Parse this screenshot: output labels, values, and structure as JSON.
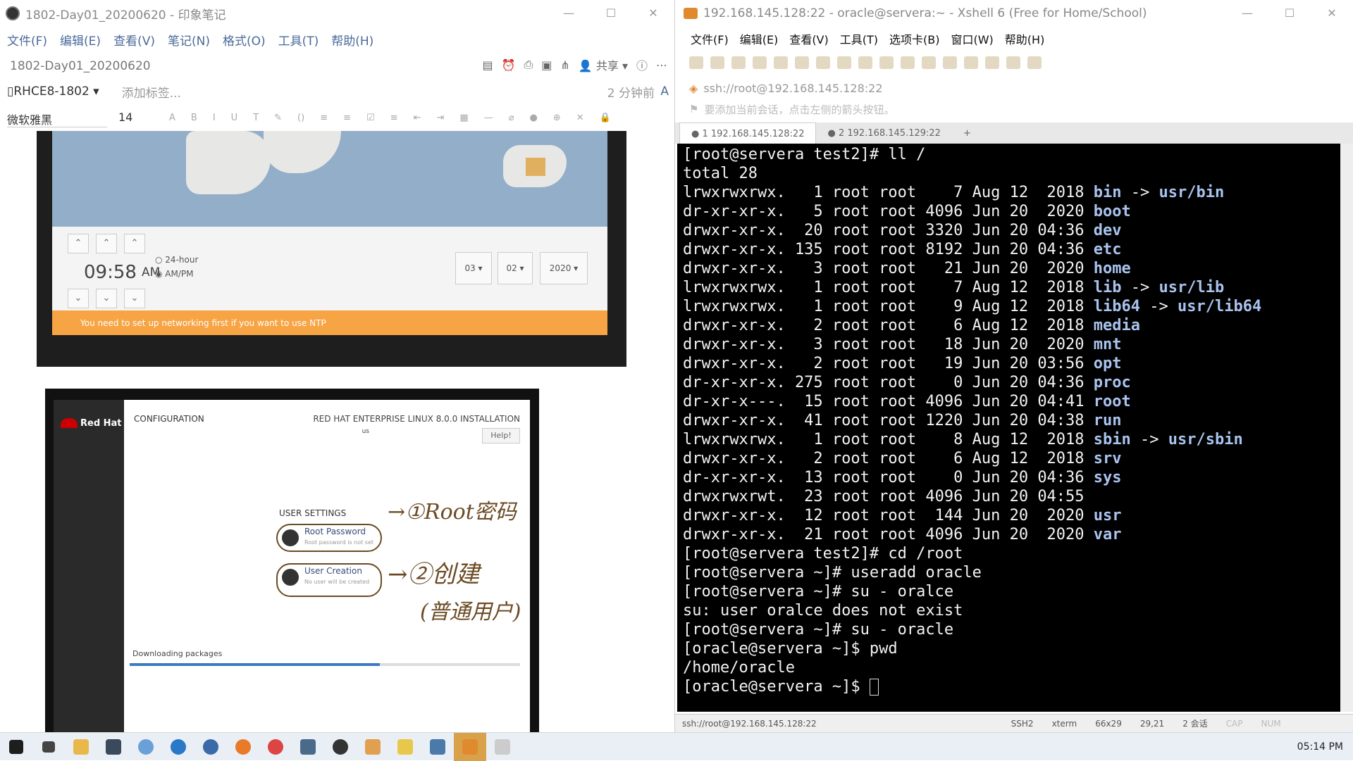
{
  "evernote": {
    "title": "1802-Day01_20200620 - 印象笔记",
    "menu": [
      "文件(F)",
      "编辑(E)",
      "查看(V)",
      "笔记(N)",
      "格式(O)",
      "工具(T)",
      "帮助(H)"
    ],
    "note_title": "1802-Day01_20200620",
    "share": "共享",
    "notebook": "RHCE8-1802",
    "add_tag": "添加标签...",
    "modified": "2 分钟前",
    "font": "微软雅黑",
    "font_size": "14"
  },
  "shot1": {
    "time": "09:58",
    "ampm": "AM",
    "opt24": "24-hour",
    "optampm": "AM/PM",
    "month": "03",
    "day": "02",
    "year": "2020",
    "warning": "You need to set up networking first if you want to use NTP"
  },
  "shot2": {
    "brand": "Red Hat",
    "config": "CONFIGURATION",
    "product": "RED HAT ENTERPRISE LINUX 8.0.0 INSTALLATION",
    "kb": "us",
    "help": "Help!",
    "user_settings": "USER SETTINGS",
    "root_pw": "Root Password",
    "root_sub": "Root password is not set",
    "user_creation": "User Creation",
    "user_sub": "No user will be created",
    "downloading": "Downloading packages",
    "progress": 0.64
  },
  "xshell": {
    "title": "192.168.145.128:22 - oracle@servera:~ - Xshell 6 (Free for Home/School)",
    "menu": [
      "文件(F)",
      "编辑(E)",
      "查看(V)",
      "工具(T)",
      "选项卡(B)",
      "窗口(W)",
      "帮助(H)"
    ],
    "address": "ssh://root@192.168.145.128:22",
    "hint": "要添加当前会话，点击左侧的箭头按钮。",
    "tabs": [
      "1 192.168.145.128:22",
      "2 192.168.145.129:22"
    ],
    "status": [
      "ssh://root@192.168.145.128:22",
      "SSH2",
      "xterm",
      "66x29",
      "29,21",
      "2 会话",
      "CAP",
      "NUM"
    ]
  },
  "terminal": {
    "lines": [
      {
        "t": "[root@servera test2]# ll /"
      },
      {
        "t": "total 28"
      },
      {
        "t": "lrwxrwxrwx.   1 root root    7 Aug 12  2018 ",
        "b": "bin",
        "a": " -> ",
        "l": "usr/bin"
      },
      {
        "t": "dr-xr-xr-x.   5 root root 4096 Jun 20  2020 ",
        "b": "boot"
      },
      {
        "t": "drwxr-xr-x.  20 root root 3320 Jun 20 04:36 ",
        "b": "dev"
      },
      {
        "t": "drwxr-xr-x. 135 root root 8192 Jun 20 04:36 ",
        "b": "etc"
      },
      {
        "t": "drwxr-xr-x.   3 root root   21 Jun 20  2020 ",
        "b": "home"
      },
      {
        "t": "lrwxrwxrwx.   1 root root    7 Aug 12  2018 ",
        "b": "lib",
        "a": " -> ",
        "l": "usr/lib"
      },
      {
        "t": "lrwxrwxrwx.   1 root root    9 Aug 12  2018 ",
        "b": "lib64",
        "a": " -> ",
        "l": "usr/lib64"
      },
      {
        "t": "drwxr-xr-x.   2 root root    6 Aug 12  2018 ",
        "b": "media"
      },
      {
        "t": "drwxr-xr-x.   3 root root   18 Jun 20  2020 ",
        "b": "mnt"
      },
      {
        "t": "drwxr-xr-x.   2 root root   19 Jun 20 03:56 ",
        "b": "opt"
      },
      {
        "t": "dr-xr-xr-x. 275 root root    0 Jun 20 04:36 ",
        "b": "proc"
      },
      {
        "t": "dr-xr-x---.  15 root root 4096 Jun 20 04:41 ",
        "b": "root"
      },
      {
        "t": "drwxr-xr-x.  41 root root 1220 Jun 20 04:38 ",
        "b": "run"
      },
      {
        "t": "lrwxrwxrwx.   1 root root    8 Aug 12  2018 ",
        "b": "sbin",
        "a": " -> ",
        "l": "usr/sbin"
      },
      {
        "t": "drwxr-xr-x.   2 root root    6 Aug 12  2018 ",
        "b": "srv"
      },
      {
        "t": "dr-xr-xr-x.  13 root root    0 Jun 20 04:36 ",
        "b": "sys"
      },
      {
        "t": "drwxrwxrwt.  23 root root 4096 Jun 20 04:55 "
      },
      {
        "t": "drwxr-xr-x.  12 root root  144 Jun 20  2020 ",
        "b": "usr"
      },
      {
        "t": "drwxr-xr-x.  21 root root 4096 Jun 20  2020 ",
        "b": "var"
      },
      {
        "t": "[root@servera test2]# cd /root"
      },
      {
        "t": "[root@servera ~]# useradd oracle"
      },
      {
        "t": "[root@servera ~]# su - oralce"
      },
      {
        "t": "su: user oralce does not exist"
      },
      {
        "t": "[root@servera ~]# su - oracle"
      },
      {
        "t": "[oracle@servera ~]$ pwd"
      },
      {
        "t": "/home/oracle"
      },
      {
        "t": "[oracle@servera ~]$ ",
        "cursor": true
      }
    ]
  },
  "taskbar": {
    "clock": "05:14 PM"
  },
  "colors": {
    "accent": "#e08a2e",
    "dir": "#a9c3ee",
    "warn": "#f7a445"
  }
}
